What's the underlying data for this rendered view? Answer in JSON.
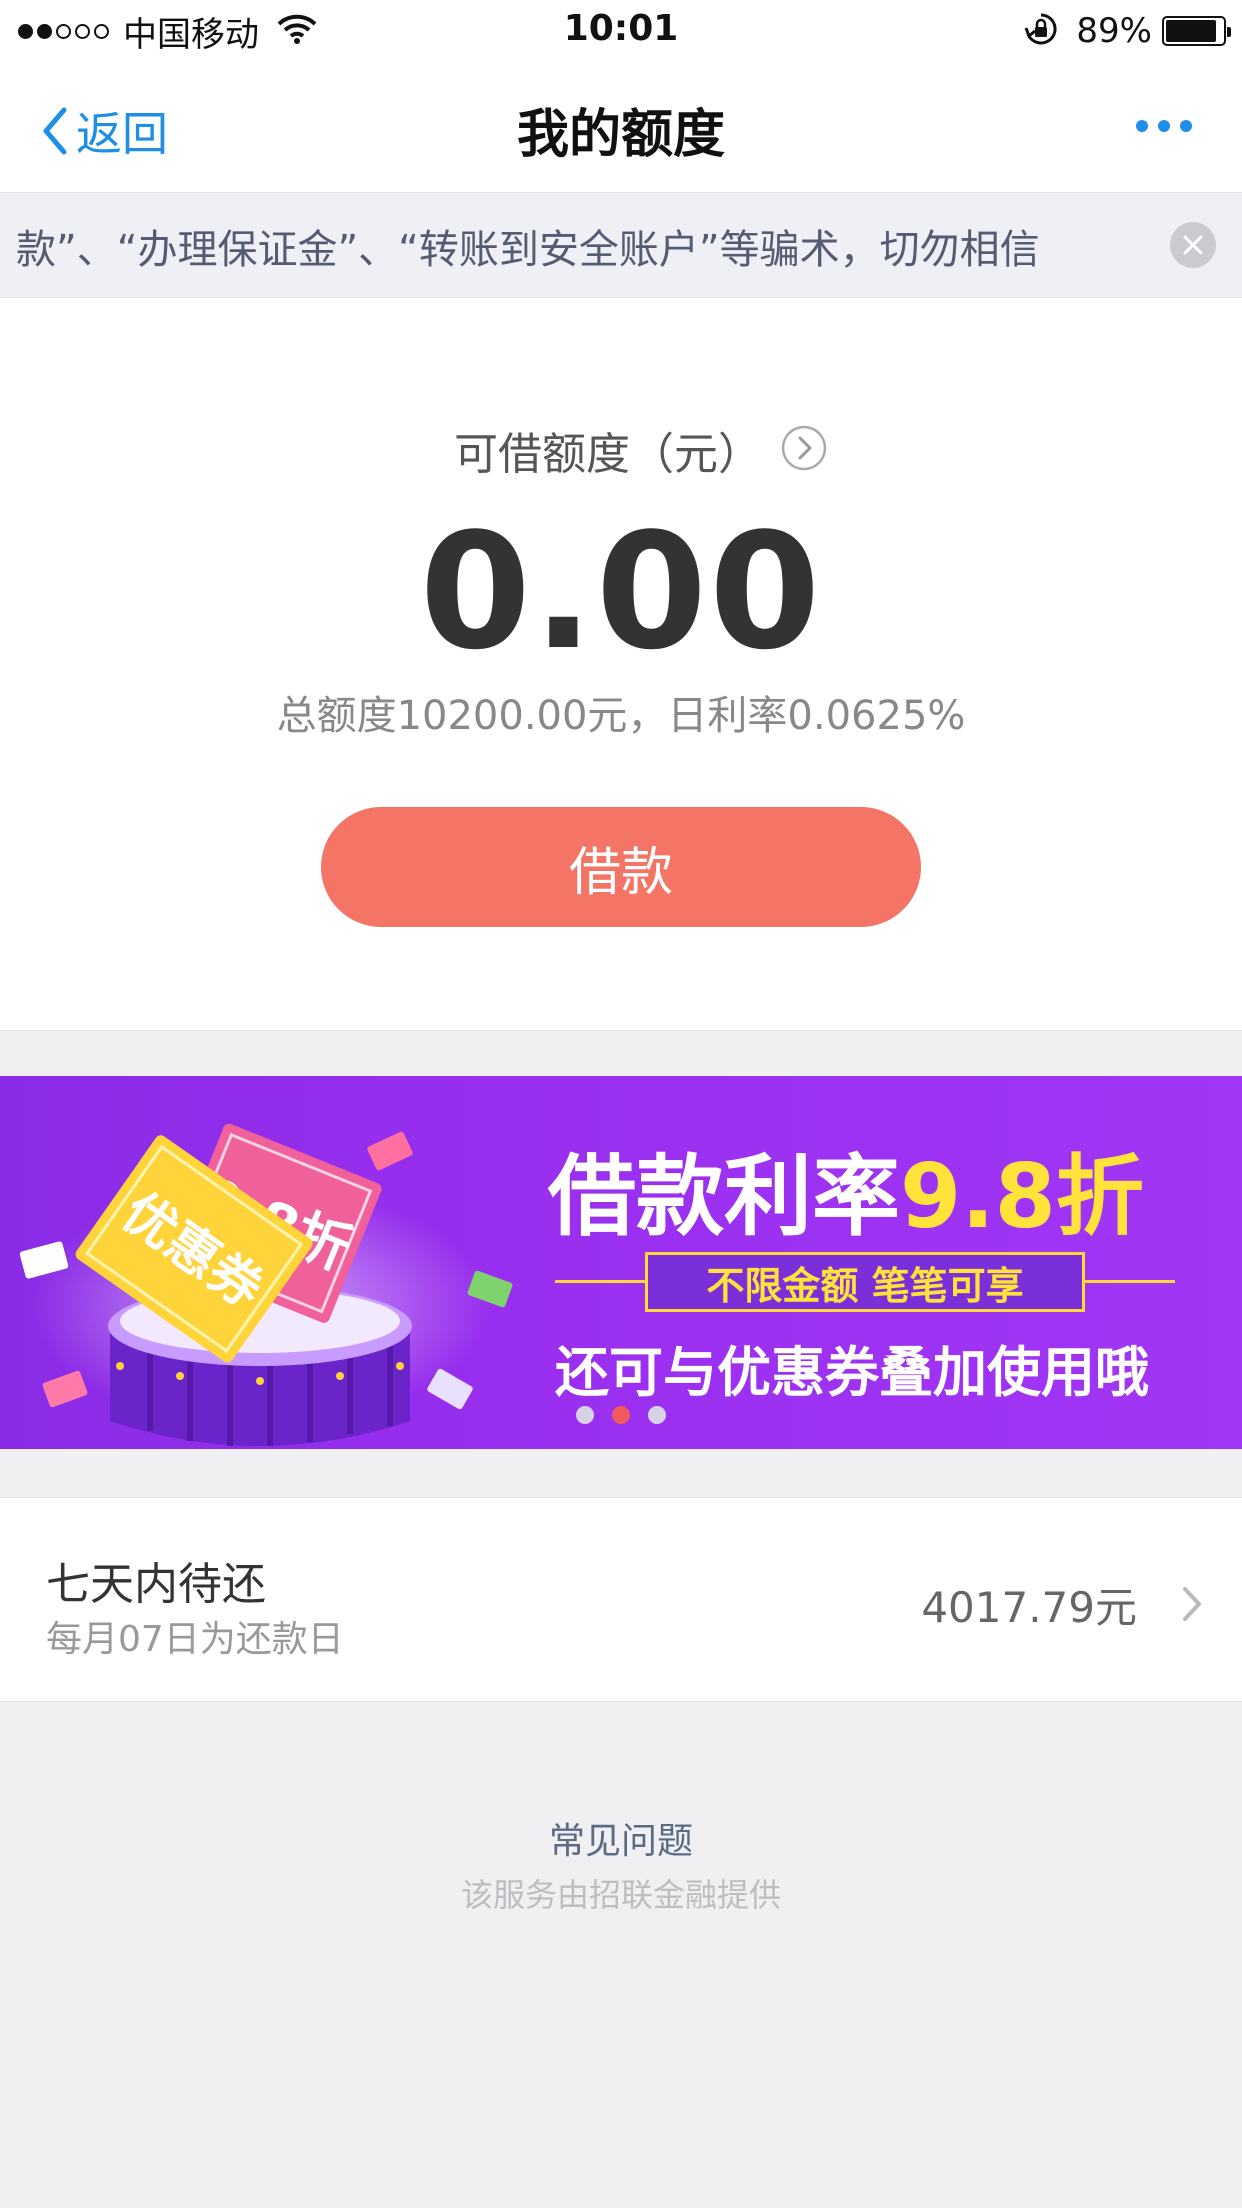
{
  "status_bar": {
    "carrier": "中国移动",
    "time": "10:01",
    "battery": "89%",
    "battery_level": 0.89,
    "signal_bars": 2,
    "icons": [
      "signal-dots-icon",
      "wifi-icon",
      "rotation-lock-icon",
      "battery-icon"
    ]
  },
  "nav": {
    "back_label": "返回",
    "title": "我的额度",
    "more_icon": "more-dots-icon"
  },
  "notice": {
    "text": "款”、“办理保证金”、“转账到安全账户”等骗术，切勿相信",
    "close_icon": "close-icon"
  },
  "quota": {
    "label": "可借额度（元）",
    "amount": "0.00",
    "summary": "总额度10200.00元，日利率0.0625%",
    "borrow_button": "借款"
  },
  "banner": {
    "headline_prefix": "借款利率",
    "headline_highlight": "9.8折",
    "tag": "不限金额 笔笔可享",
    "tagline": "还可与优惠券叠加使用哦",
    "coupon_text": "优惠券",
    "coupon_back_text": "9.8折",
    "page_count": 3,
    "active_page": 2
  },
  "repay": {
    "title": "七天内待还",
    "subtitle": "每月07日为还款日",
    "amount": "4017.79元"
  },
  "footer": {
    "faq": "常见问题",
    "provider": "该服务由招联金融提供"
  },
  "colors": {
    "accent_blue": "#1e8ee6",
    "borrow_button": "#f47466",
    "banner_purple": "#9a2ff0",
    "banner_yellow": "#ffe23a",
    "page_bg": "#f0f0f2"
  }
}
